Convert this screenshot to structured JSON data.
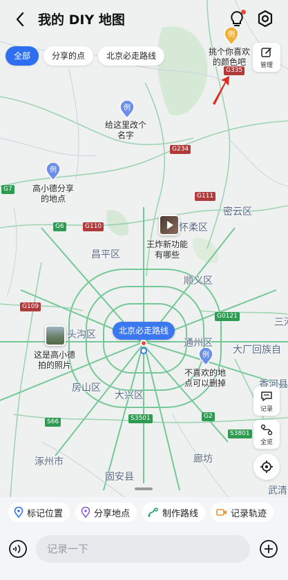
{
  "header": {
    "title": "我的 DIY 地图"
  },
  "filters": [
    "全部",
    "分享的点",
    "北京必走路线"
  ],
  "manage_label": "管理",
  "pins": [
    {
      "badge": "例",
      "label_lines": [
        "挑个你喜欢",
        "的颜色吧"
      ],
      "color": "#f0b13a"
    },
    {
      "badge": "例",
      "label_lines": [
        "给这里改个",
        "名字"
      ],
      "color": "#6b8ee8"
    },
    {
      "badge": "例",
      "label_lines": [
        "高小德分享",
        "的地点"
      ],
      "color": "#6b8ee8"
    },
    {
      "badge": "例",
      "label_lines": [
        "不喜欢的地",
        "点可以删掉"
      ],
      "color": "#6b8ee8"
    }
  ],
  "photo_points": [
    {
      "label_lines": [
        "王炸新功能",
        "有哪些"
      ]
    },
    {
      "label_lines": [
        "这是高小德",
        "拍的照片"
      ]
    }
  ],
  "route_label": "北京必走路线",
  "places": [
    "密云区",
    "怀柔区",
    "昌平区",
    "顺义区",
    "头沟区",
    "通州区",
    "大厂回族自",
    "三河",
    "香河县",
    "大兴区",
    "房山区",
    "涿州市",
    "廊坊",
    "固安县",
    "武清"
  ],
  "roads": [
    "G335",
    "G234",
    "G111",
    "G7",
    "G6",
    "G110",
    "G109",
    "G0121",
    "G2",
    "S66",
    "S3501",
    "S3801"
  ],
  "side_buttons": {
    "record": "记录",
    "overview": "全览"
  },
  "bottom_tabs": [
    "标记位置",
    "分享地点",
    "制作路线",
    "记录轨迹"
  ],
  "input_placeholder": "记录一下",
  "colors": {
    "accent": "#2d6ff0",
    "road_green": "#3aa866",
    "tab_bg": "#f4f5f7"
  }
}
